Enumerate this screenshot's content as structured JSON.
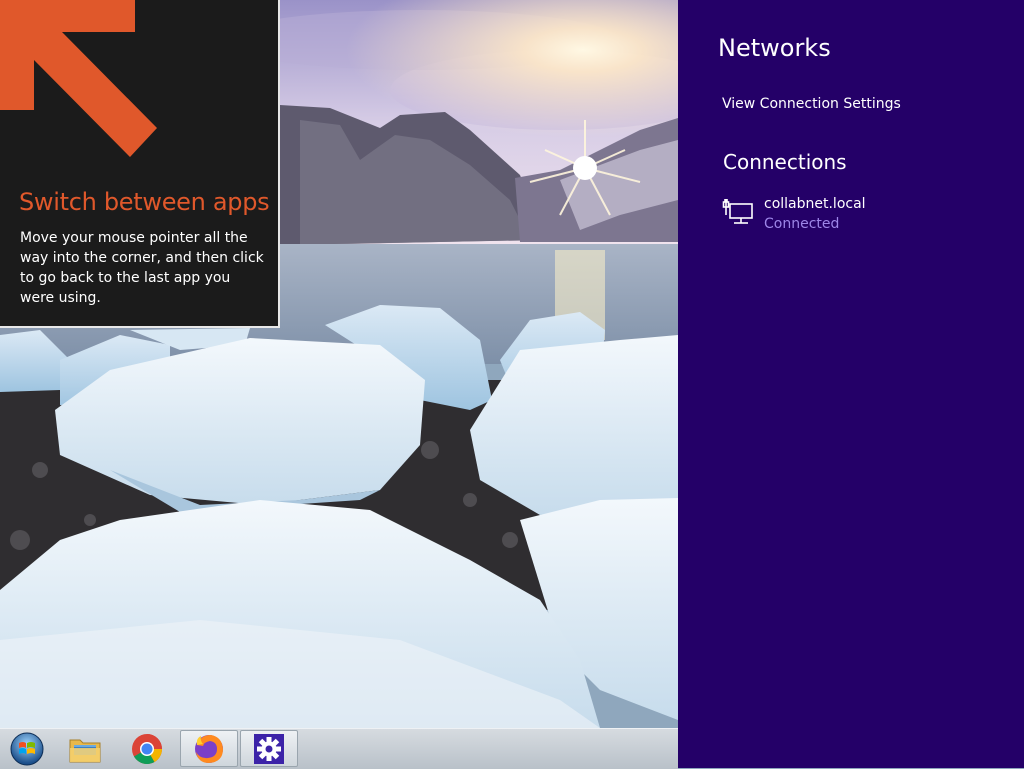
{
  "tip": {
    "title": "Switch between apps",
    "text": "Move your mouse pointer all the way into the corner, and then click to go back to the last app you were using."
  },
  "charm": {
    "title": "Networks",
    "view_settings": "View Connection Settings",
    "section_title": "Connections",
    "connections": [
      {
        "name": "collabnet.local",
        "status": "Connected",
        "icon": "wired-network-icon"
      }
    ]
  },
  "taskbar": {
    "items": [
      {
        "name": "start-button",
        "icon": "windows-logo-icon"
      },
      {
        "name": "file-explorer",
        "icon": "folder-icon"
      },
      {
        "name": "chrome",
        "icon": "chrome-icon"
      },
      {
        "name": "firefox",
        "icon": "firefox-icon",
        "active": true
      },
      {
        "name": "settings",
        "icon": "gear-icon",
        "active": true
      }
    ]
  },
  "colors": {
    "charm_bg": "#240068",
    "tip_accent": "#e0582b",
    "connected_text": "#9d86e8"
  }
}
